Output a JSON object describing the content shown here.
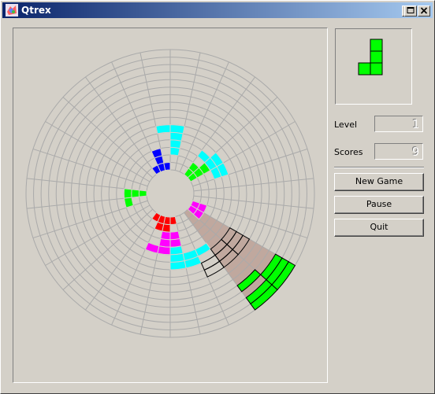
{
  "window": {
    "title": "Qtrex"
  },
  "stats": {
    "level_label": "Level",
    "level_value": "1",
    "scores_label": "Scores",
    "scores_value": "9"
  },
  "buttons": {
    "new_game": "New Game",
    "pause": "Pause",
    "quit": "Quit"
  },
  "colors": {
    "green": "#00ff00",
    "cyan": "#00ffff",
    "magenta": "#ff00ff",
    "red": "#ff0000",
    "blue": "#0000ff",
    "shadow": "#c0a89e",
    "grid": "#aaaaaa",
    "board_bg": "#d4d0c8"
  },
  "game": {
    "rings": 16,
    "sectors": 30,
    "falling_piece": {
      "color": "green",
      "cells": [
        [
          0,
          10
        ],
        [
          0,
          11
        ],
        [
          1,
          10
        ],
        [
          1,
          11
        ],
        [
          2,
          10
        ],
        [
          3,
          11
        ]
      ]
    },
    "landing_outline": [
      [
        7,
        10
      ],
      [
        7,
        11
      ],
      [
        7,
        12
      ],
      [
        8,
        10
      ],
      [
        8,
        11
      ],
      [
        8,
        12
      ],
      [
        9,
        10
      ],
      [
        9,
        11
      ]
    ],
    "cells": [
      {
        "color": "magenta",
        "cells": [
          [
            14,
            9
          ],
          [
            14,
            10
          ],
          [
            15,
            9
          ],
          [
            15,
            10
          ]
        ]
      },
      {
        "color": "cyan",
        "cells": [
          [
            9,
            14
          ],
          [
            10,
            14
          ],
          [
            11,
            14
          ],
          [
            9,
            13
          ],
          [
            10,
            13
          ],
          [
            10,
            12
          ]
        ]
      },
      {
        "color": "magenta",
        "cells": [
          [
            12,
            14
          ],
          [
            13,
            14
          ],
          [
            12,
            15
          ],
          [
            13,
            15
          ],
          [
            11,
            15
          ],
          [
            11,
            16
          ]
        ]
      },
      {
        "color": "red",
        "cells": [
          [
            14,
            15
          ],
          [
            14,
            16
          ],
          [
            15,
            14
          ],
          [
            15,
            15
          ],
          [
            15,
            16
          ],
          [
            15,
            17
          ]
        ]
      },
      {
        "color": "green",
        "cells": [
          [
            13,
            22
          ],
          [
            14,
            22
          ],
          [
            15,
            22
          ],
          [
            13,
            21
          ]
        ]
      },
      {
        "color": "blue",
        "cells": [
          [
            13,
            28
          ],
          [
            14,
            28
          ],
          [
            15,
            28
          ],
          [
            15,
            27
          ],
          [
            15,
            29
          ]
        ]
      },
      {
        "color": "green",
        "cells": [
          [
            14,
            3
          ],
          [
            14,
            4
          ],
          [
            15,
            3
          ],
          [
            15,
            4
          ],
          [
            13,
            4
          ]
        ]
      },
      {
        "color": "cyan",
        "cells": [
          [
            12,
            3
          ],
          [
            12,
            4
          ],
          [
            11,
            4
          ],
          [
            11,
            5
          ],
          [
            12,
            5
          ]
        ]
      },
      {
        "color": "cyan",
        "cells": [
          [
            13,
            0
          ],
          [
            12,
            0
          ],
          [
            11,
            0
          ],
          [
            10,
            0
          ],
          [
            10,
            29
          ]
        ]
      }
    ]
  },
  "next_piece": {
    "color": "green",
    "cells": [
      [
        1,
        0
      ],
      [
        1,
        1
      ],
      [
        1,
        2
      ],
      [
        0,
        2
      ]
    ]
  }
}
